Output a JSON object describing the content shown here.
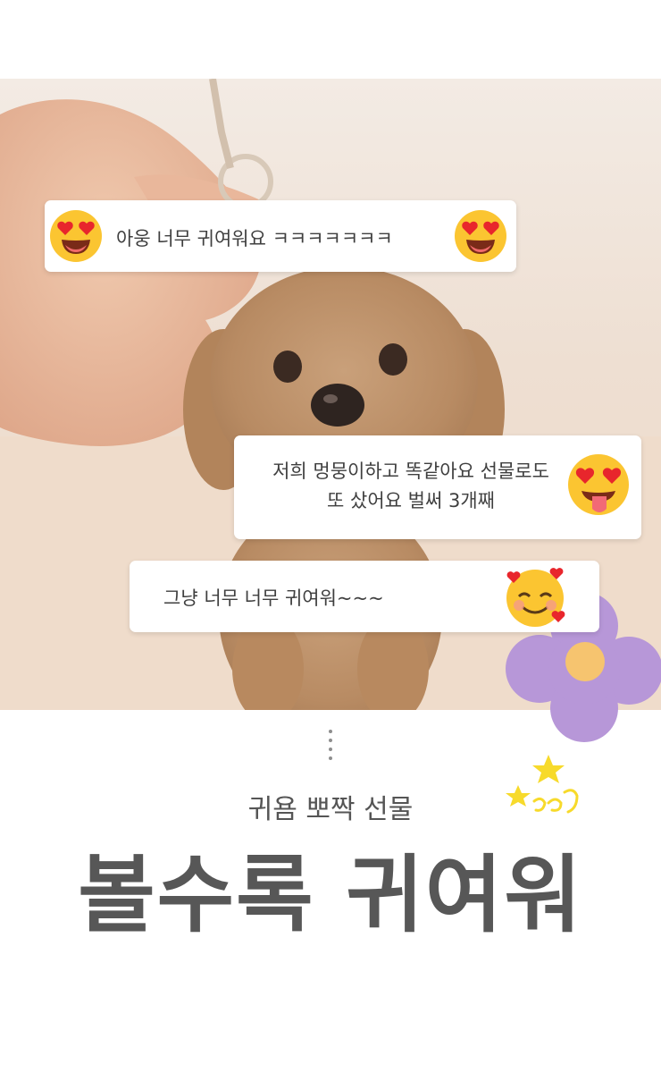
{
  "bubbles": {
    "first": "아웅 너무 귀여워요 ㅋㅋㅋㅋㅋㅋㅋ",
    "second_line1": "저희 멍뭉이하고 똑같아요 선물로도",
    "second_line2": "또 샀어요 벌써 3개째",
    "third": "그냥 너무 너무 귀여워~~~"
  },
  "subtitle": "귀욤 뽀짝 선물",
  "title": "볼수록 귀여워",
  "colors": {
    "text_dark": "#575757",
    "flower": "#b797d8",
    "flower_center": "#f6c46f",
    "star": "#f7da2b",
    "emoji_face": "#fbc531"
  },
  "icons": [
    "heart-eyes-emoji-icon",
    "tongue-emoji-icon",
    "smiling-hearts-emoji-icon",
    "flower-icon",
    "stars-icon"
  ]
}
